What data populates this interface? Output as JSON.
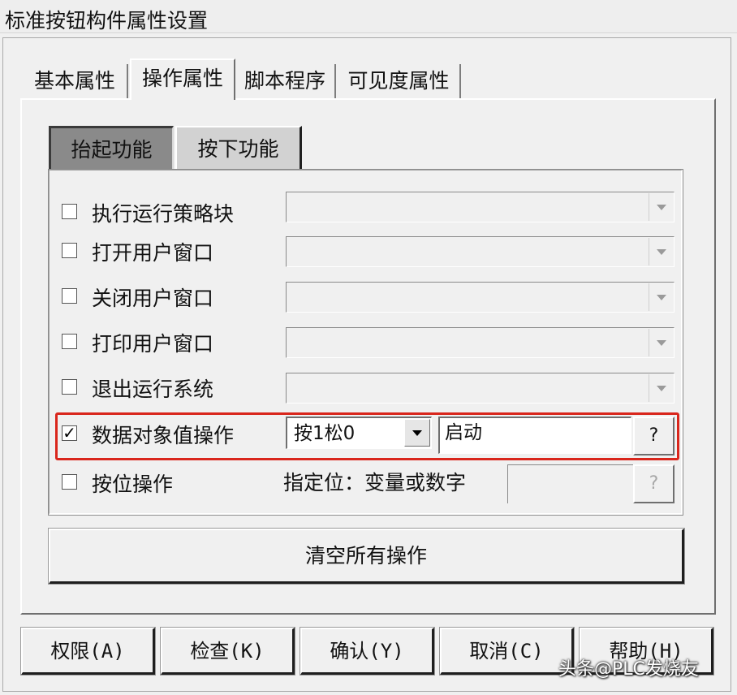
{
  "window": {
    "title": "标准按钮构件属性设置"
  },
  "tabs": [
    {
      "label": "基本属性",
      "active": false
    },
    {
      "label": "操作属性",
      "active": true
    },
    {
      "label": "脚本程序",
      "active": false
    },
    {
      "label": "可见度属性",
      "active": false
    }
  ],
  "subtabs": [
    {
      "label": "抬起功能",
      "pressed": true
    },
    {
      "label": "按下功能",
      "pressed": false
    }
  ],
  "actions": [
    {
      "label": "执行运行策略块",
      "checked": false,
      "value": ""
    },
    {
      "label": "打开用户窗口",
      "checked": false,
      "value": ""
    },
    {
      "label": "关闭用户窗口",
      "checked": false,
      "value": ""
    },
    {
      "label": "打印用户窗口",
      "checked": false,
      "value": ""
    },
    {
      "label": "退出运行系统",
      "checked": false,
      "value": ""
    }
  ],
  "data_op": {
    "label": "数据对象值操作",
    "checked": true,
    "mode": "按1松0",
    "variable": "启动",
    "help_label": "?"
  },
  "bit_op": {
    "label": "按位操作",
    "checked": false,
    "hint": "指定位：变量或数字",
    "help_label": "?"
  },
  "clear_button": "清空所有操作",
  "footer": {
    "permission": "权限(A)",
    "check": "检查(K)",
    "confirm": "确认(Y)",
    "cancel": "取消(C)",
    "help": "帮助(H)"
  },
  "watermark": {
    "icon": "wechat-icon",
    "text": "头条@PLC发烧友"
  },
  "checkbox_mark": "✓",
  "colors": {
    "highlight": "#d9261c",
    "pressed_tab": "#8a8a8a",
    "background": "#f0f0f0"
  }
}
